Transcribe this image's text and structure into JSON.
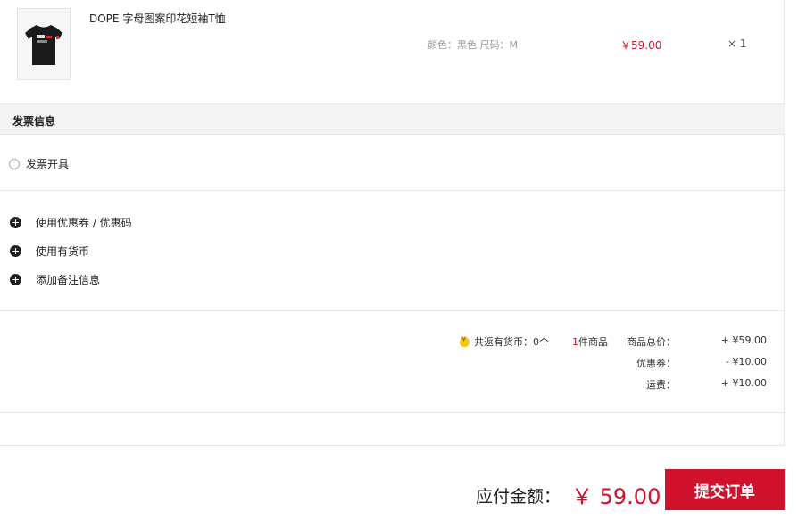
{
  "product": {
    "name": "DOPE 字母图案印花短袖T恤",
    "spec": "颜色：黑色  尺码：M",
    "price": "￥59.00",
    "qty": "× 1"
  },
  "invoice": {
    "title": "发票信息",
    "option_label": "发票开具"
  },
  "extras": [
    {
      "label": "使用优惠券 / 优惠码"
    },
    {
      "label": "使用有货币"
    },
    {
      "label": "添加备注信息"
    }
  ],
  "summary": {
    "coin_text": "共返有货币：0个",
    "count_num": "1",
    "count_suffix": "件商品",
    "rows": [
      {
        "label": "商品总价：",
        "value": "+ ¥59.00"
      },
      {
        "label": "优惠券：",
        "value": "- ¥10.00"
      },
      {
        "label": "运费：",
        "value": "+ ¥10.00"
      }
    ]
  },
  "footer": {
    "pay_label": "应付金额：",
    "pay_amount": "￥ 59.00",
    "submit_label": "提交订单"
  },
  "colors": {
    "accent": "#d0112b",
    "coin": "#f5c518"
  }
}
